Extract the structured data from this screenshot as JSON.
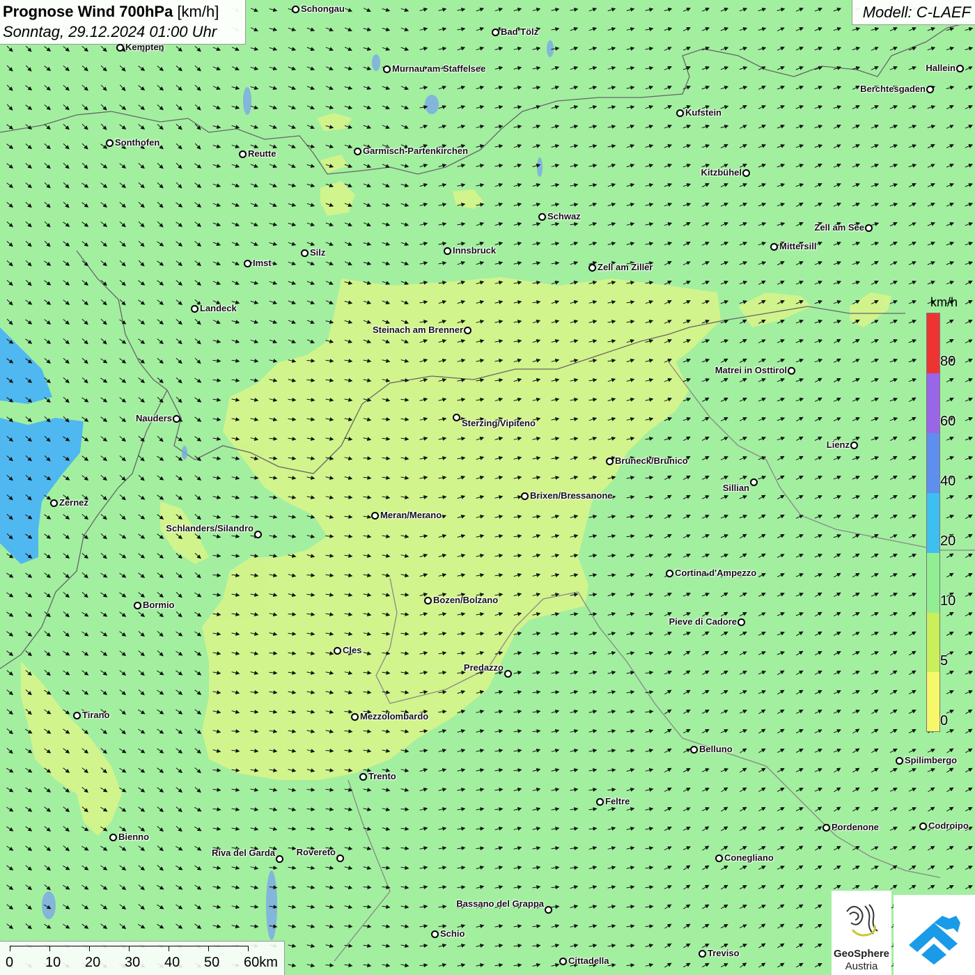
{
  "title": {
    "main": "Prognose Wind 700hPa",
    "unit": "[km/h]",
    "date": "Sonntag, 29.12.2024 01:00 Uhr"
  },
  "model": "Modell: C-LAEF",
  "colors": {
    "background": "#a2efa0",
    "low_wind": "#d7f48a",
    "medium_wind": "#4fb8f0",
    "border": "#666666"
  },
  "legend": {
    "unit": "km/h",
    "labels": [
      "80",
      "60",
      "40",
      "20",
      "10",
      "5",
      "0"
    ],
    "segments": [
      {
        "color": "#ee3333"
      },
      {
        "color": "#9966e8"
      },
      {
        "color": "#5f8fee"
      },
      {
        "color": "#3dbff0"
      },
      {
        "color": "#92ee92"
      },
      {
        "color": "#c9f05a"
      },
      {
        "color": "#f7f76a"
      }
    ]
  },
  "scale": {
    "labels": [
      "0",
      "10",
      "20",
      "30",
      "40",
      "50",
      "60km"
    ]
  },
  "logo": {
    "name_line1": "GeoSphere",
    "name_line2": "Austria"
  },
  "cities": [
    {
      "name": "Schongau"
    },
    {
      "name": "Bad Tölz"
    },
    {
      "name": "Kempten"
    },
    {
      "name": "Murnau am Staffelsee"
    },
    {
      "name": "Hallein"
    },
    {
      "name": "Berchtesgaden"
    },
    {
      "name": "Kufstein"
    },
    {
      "name": "Sonthofen"
    },
    {
      "name": "Reutte"
    },
    {
      "name": "Garmisch-Partenkirchen"
    },
    {
      "name": "Kitzbühel"
    },
    {
      "name": "Schwaz"
    },
    {
      "name": "Zell am See"
    },
    {
      "name": "Mittersill"
    },
    {
      "name": "Innsbruck"
    },
    {
      "name": "Silz"
    },
    {
      "name": "Imst"
    },
    {
      "name": "Zell am Ziller"
    },
    {
      "name": "Landeck"
    },
    {
      "name": "Steinach am Brenner"
    },
    {
      "name": "Matrei in Osttirol"
    },
    {
      "name": "Nauders"
    },
    {
      "name": "Sterzing/Vipiteno"
    },
    {
      "name": "Lienz"
    },
    {
      "name": "Bruneck/Brunico"
    },
    {
      "name": "Sillian"
    },
    {
      "name": "Brixen/Bressanone"
    },
    {
      "name": "Zernez"
    },
    {
      "name": "Meran/Merano"
    },
    {
      "name": "Schlanders/Silandro"
    },
    {
      "name": "Cortina d'Ampezzo"
    },
    {
      "name": "Bozen/Bolzano"
    },
    {
      "name": "Bormio"
    },
    {
      "name": "Pieve di Cadore"
    },
    {
      "name": "Cles"
    },
    {
      "name": "Predazzo"
    },
    {
      "name": "Tirano"
    },
    {
      "name": "Mezzolombardo"
    },
    {
      "name": "Belluno"
    },
    {
      "name": "Spilimbergo"
    },
    {
      "name": "Trento"
    },
    {
      "name": "Feltre"
    },
    {
      "name": "Bienno"
    },
    {
      "name": "Pordenone"
    },
    {
      "name": "Codroipo"
    },
    {
      "name": "Riva del Garda"
    },
    {
      "name": "Rovereto"
    },
    {
      "name": "Conegliano"
    },
    {
      "name": "Bassano del Grappa"
    },
    {
      "name": "Schio"
    },
    {
      "name": "Treviso"
    },
    {
      "name": "Cittadella"
    }
  ]
}
